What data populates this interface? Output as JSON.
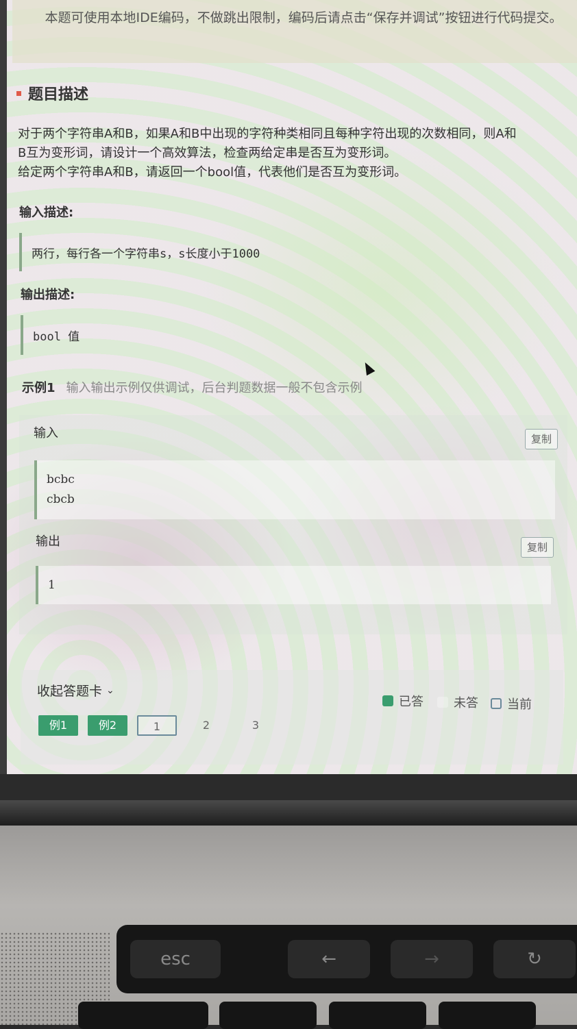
{
  "notice": "本题可使用本地IDE编码，不做跳出限制，编码后请点击“保存并调试”按钮进行代码提交。",
  "section": {
    "title": "题目描述"
  },
  "description": {
    "line1": "对于两个字符串A和B，如果A和B中出现的字符种类相同且每种字符出现的次数相同，则A和",
    "line2": "B互为变形词，请设计一个高效算法，检查两给定串是否互为变形词。",
    "line3": "给定两个字符串A和B，请返回一个bool值，代表他们是否互为变形词。"
  },
  "input_desc": {
    "title": "输入描述:",
    "text": "两行，每行各一个字符串s，s长度小于1000"
  },
  "output_desc": {
    "title": "输出描述:",
    "text": "bool 值"
  },
  "example": {
    "label": "示例1",
    "note": "输入输出示例仅供调试，后台判题数据一般不包含示例",
    "input_label": "输入",
    "input_lines": [
      "bcbc",
      "cbcb"
    ],
    "output_label": "输出",
    "output_lines": [
      "1"
    ],
    "copy_label": "复制"
  },
  "answer_card": {
    "collapse_label": "收起答题卡",
    "legend": {
      "answered": "已答",
      "unanswered": "未答",
      "current": "当前"
    },
    "questions": [
      "例1",
      "例2",
      "1",
      "2",
      "3"
    ]
  },
  "keyboard": {
    "esc": "esc",
    "back": "←",
    "forward": "→",
    "refresh": "↻"
  },
  "colors": {
    "answered": "#3a9d6e",
    "accent_bar": "#e05a4a"
  }
}
